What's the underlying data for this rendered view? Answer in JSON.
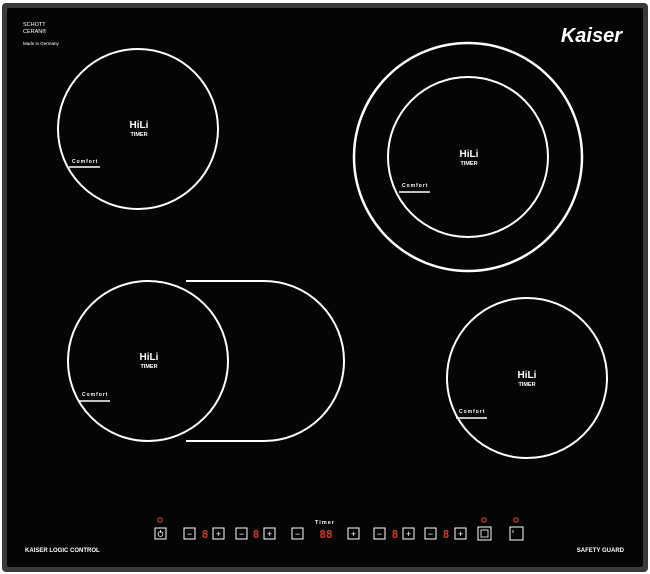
{
  "brand": {
    "schott_line1": "SCHOTT",
    "schott_line2": "CERAN®",
    "made_in": "Made in Germany",
    "logo_text": "Kaiser"
  },
  "zones": [
    {
      "title": "HiLi",
      "subtitle": "TIMER",
      "comfort": "Comfort"
    },
    {
      "title": "HiLi",
      "subtitle": "TIMER",
      "comfort": "Comfort"
    },
    {
      "title": "HiLi",
      "subtitle": "TIMER",
      "comfort": "Comfort"
    },
    {
      "title": "HiLi",
      "subtitle": "TIMER",
      "comfort": "Comfort"
    }
  ],
  "controls": {
    "timer_label": "Timer",
    "left_label": "KAISER LOGIC CONTROL",
    "right_label": "SAFETY GUARD",
    "zone_displays": [
      "8",
      "8",
      "8",
      "8"
    ],
    "timer_display": "88",
    "minus_symbol": "−",
    "plus_symbol": "+"
  },
  "colors": {
    "glass": "#050505",
    "frame": "#3a3a3a",
    "print": "#ffffff",
    "led": "#d23a2a"
  }
}
